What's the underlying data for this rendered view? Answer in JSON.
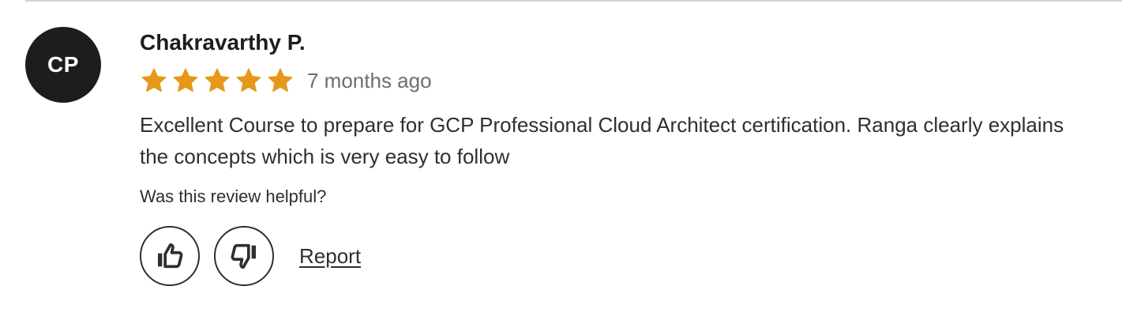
{
  "review": {
    "avatar_initials": "CP",
    "reviewer_name": "Chakravarthy P.",
    "rating": 5,
    "rating_max": 5,
    "date": "7 months ago",
    "text": "Excellent Course to prepare for GCP Professional Cloud Architect certification. Ranga clearly explains the concepts which is very easy to follow",
    "helpful_question": "Was this review helpful?",
    "report_label": "Report"
  },
  "icons": {
    "thumbs_up": "thumbs-up-icon",
    "thumbs_down": "thumbs-down-icon",
    "star": "star-icon"
  },
  "colors": {
    "star": "#e59819",
    "avatar_bg": "#1c1d1f",
    "text": "#2d2f31",
    "muted": "#6a6f73",
    "divider": "#d1d2e0"
  }
}
